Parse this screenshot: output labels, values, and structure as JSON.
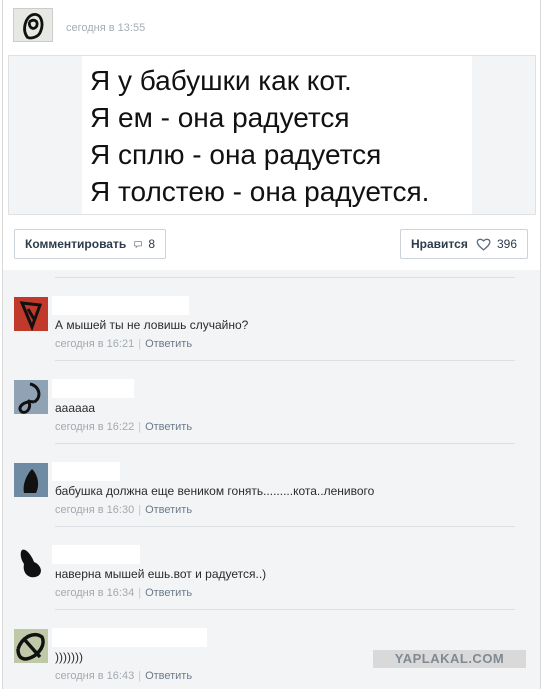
{
  "post": {
    "time": "сегодня в 13:55",
    "lines": [
      "Я у бабушки как кот.",
      "Я ем - она радуется",
      "Я сплю - она радуется",
      "Я толстею - она радуется."
    ]
  },
  "actions": {
    "comment_label": "Комментировать",
    "comment_count": "8",
    "like_label": "Нравится",
    "like_count": "396"
  },
  "comments": [
    {
      "text": "А мышей ты не ловишь случайно?",
      "time": "сегодня в 16:21",
      "reply": "Ответить",
      "avatar": "red-black-scribble"
    },
    {
      "text": "аааааа",
      "time": "сегодня в 16:22",
      "reply": "Ответить",
      "avatar": "black-scribble"
    },
    {
      "text": "бабушка должна еще веником гонять.........кота..ленивого",
      "time": "сегодня в 16:30",
      "reply": "Ответить",
      "avatar": "black-scribble"
    },
    {
      "text": "наверна мышей ешь.вот и радуется..)",
      "time": "сегодня в 16:34",
      "reply": "Ответить",
      "avatar": "black-scribble"
    },
    {
      "text": ")))))))",
      "time": "сегодня в 16:43",
      "reply": "Ответить",
      "avatar": "black-scribble"
    }
  ],
  "watermark": "YAPLAKAL.COM"
}
